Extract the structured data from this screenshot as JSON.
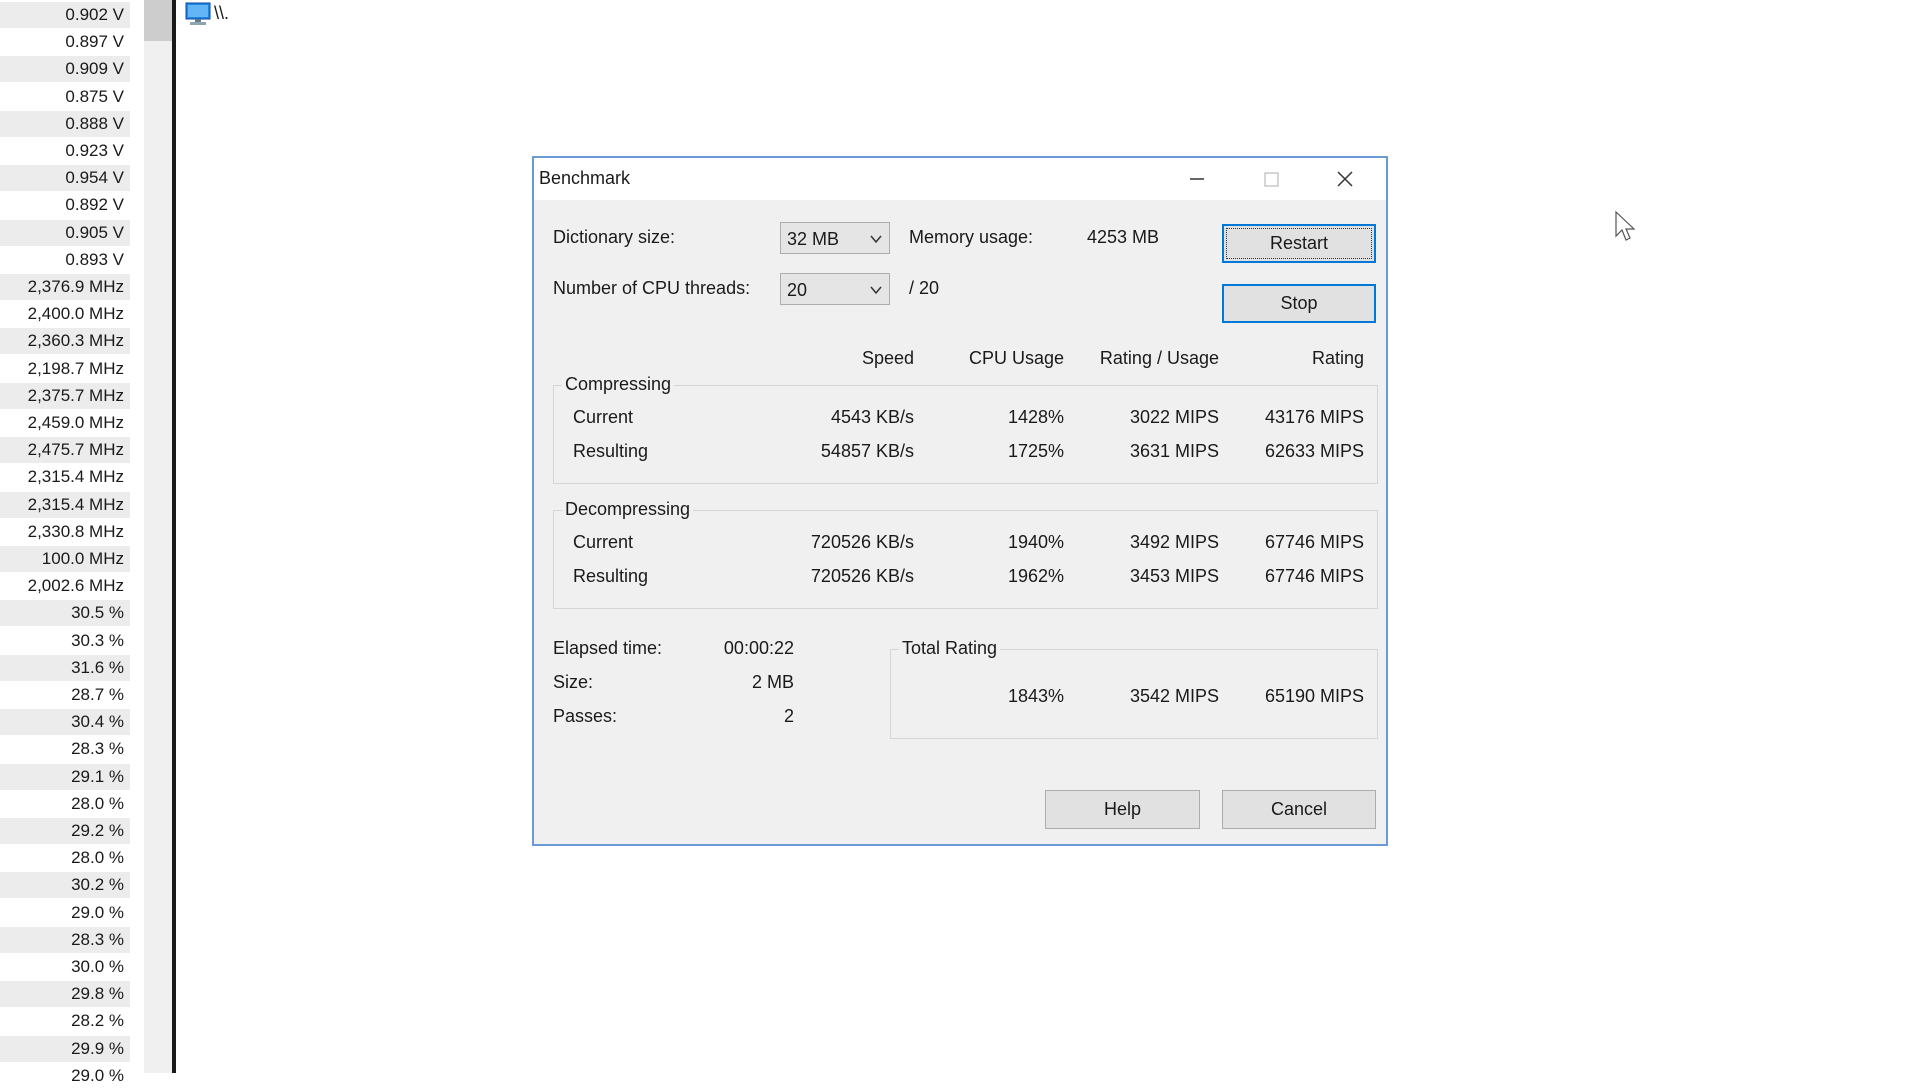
{
  "sensors": [
    "0.902 V",
    "0.897 V",
    "0.909 V",
    "0.875 V",
    "0.888 V",
    "0.923 V",
    "0.954 V",
    "0.892 V",
    "0.905 V",
    "0.893 V",
    "2,376.9 MHz",
    "2,400.0 MHz",
    "2,360.3 MHz",
    "2,198.7 MHz",
    "2,375.7 MHz",
    "2,459.0 MHz",
    "2,475.7 MHz",
    "2,315.4 MHz",
    "2,315.4 MHz",
    "2,330.8 MHz",
    "100.0 MHz",
    "2,002.6 MHz",
    "30.5 %",
    "30.3 %",
    "31.6 %",
    "28.7 %",
    "30.4 %",
    "28.3 %",
    "29.1 %",
    "28.0 %",
    "29.2 %",
    "28.0 %",
    "30.2 %",
    "29.0 %",
    "28.3 %",
    "30.0 %",
    "29.8 %",
    "28.2 %",
    "29.9 %",
    "29.0 %"
  ],
  "tree": {
    "label": "\\\\."
  },
  "dialog": {
    "title": "Benchmark",
    "dict_label": "Dictionary size:",
    "dict_value": "32 MB",
    "threads_label": "Number of CPU threads:",
    "threads_value": "20",
    "threads_max": "/ 20",
    "memory_label": "Memory usage:",
    "memory_value": "4253 MB",
    "restart": "Restart",
    "stop": "Stop",
    "columns": {
      "speed": "Speed",
      "cpu": "CPU Usage",
      "rating_usage": "Rating / Usage",
      "rating": "Rating"
    },
    "compressing": {
      "title": "Compressing",
      "current": {
        "label": "Current",
        "speed": "4543 KB/s",
        "cpu": "1428%",
        "ru": "3022 MIPS",
        "rating": "43176 MIPS"
      },
      "resulting": {
        "label": "Resulting",
        "speed": "54857 KB/s",
        "cpu": "1725%",
        "ru": "3631 MIPS",
        "rating": "62633 MIPS"
      }
    },
    "decompressing": {
      "title": "Decompressing",
      "current": {
        "label": "Current",
        "speed": "720526 KB/s",
        "cpu": "1940%",
        "ru": "3492 MIPS",
        "rating": "67746 MIPS"
      },
      "resulting": {
        "label": "Resulting",
        "speed": "720526 KB/s",
        "cpu": "1962%",
        "ru": "3453 MIPS",
        "rating": "67746 MIPS"
      }
    },
    "elapsed_label": "Elapsed time:",
    "elapsed_value": "00:00:22",
    "size_label": "Size:",
    "size_value": "2 MB",
    "passes_label": "Passes:",
    "passes_value": "2",
    "total": {
      "title": "Total Rating",
      "cpu": "1843%",
      "ru": "3542 MIPS",
      "rating": "65190 MIPS"
    },
    "help": "Help",
    "cancel": "Cancel"
  },
  "icons": {
    "computer": "computer-icon",
    "minimize": "minimize-icon",
    "maximize": "maximize-icon",
    "close": "close-icon",
    "chevron": "chevron-down-icon",
    "cursor": "mouse-pointer-icon"
  }
}
